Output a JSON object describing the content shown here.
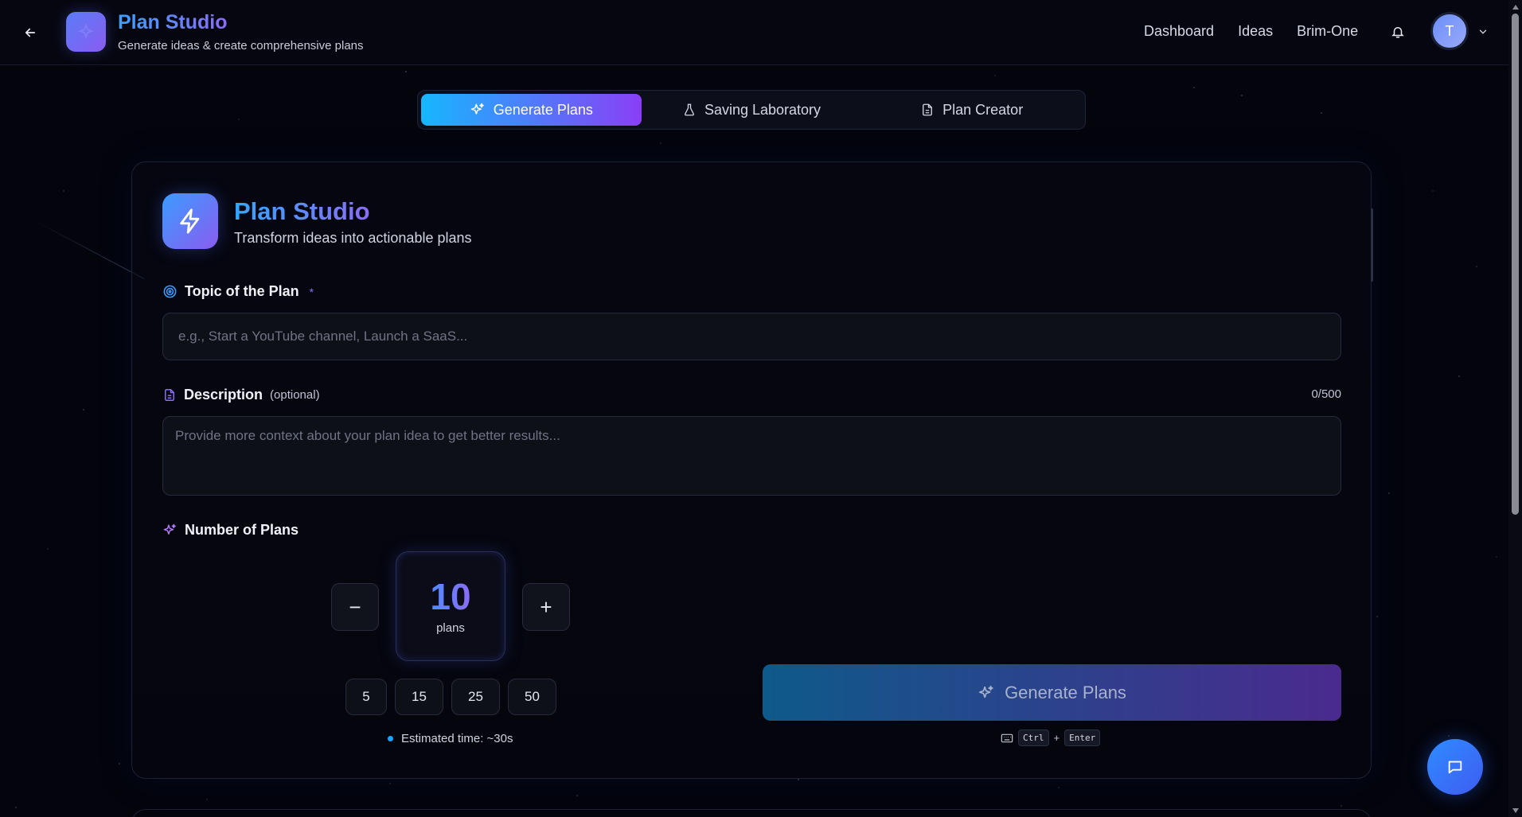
{
  "header": {
    "title": "Plan Studio",
    "subtitle": "Generate ideas & create comprehensive plans",
    "nav": [
      "Dashboard",
      "Ideas",
      "Brim-One"
    ],
    "avatar_initial": "T"
  },
  "tabs": [
    {
      "label": "Generate Plans",
      "icon": "sparkles-icon",
      "active": true
    },
    {
      "label": "Saving Laboratory",
      "icon": "flask-icon",
      "active": false
    },
    {
      "label": "Plan Creator",
      "icon": "document-icon",
      "active": false
    }
  ],
  "card": {
    "title": "Plan Studio",
    "subtitle": "Transform ideas into actionable plans",
    "topic": {
      "label": "Topic of the Plan",
      "required_mark": "*",
      "placeholder": "e.g., Start a YouTube channel, Launch a SaaS...",
      "value": ""
    },
    "description": {
      "label": "Description",
      "optional_note": "(optional)",
      "counter": "0/500",
      "placeholder": "Provide more context about your plan idea to get better results...",
      "value": ""
    },
    "plans": {
      "label": "Number of Plans",
      "value": "10",
      "unit": "plans",
      "decrement": "−",
      "increment": "+",
      "presets": [
        "5",
        "15",
        "25",
        "50"
      ],
      "estimate": "Estimated time: ~30s"
    },
    "generate_button": "Generate Plans",
    "shortcut": {
      "key1": "Ctrl",
      "plus": "+",
      "key2": "Enter"
    }
  },
  "colors": {
    "accent_blue": "#16b7ff",
    "accent_purple": "#8a3ff5",
    "background": "#03040c"
  }
}
